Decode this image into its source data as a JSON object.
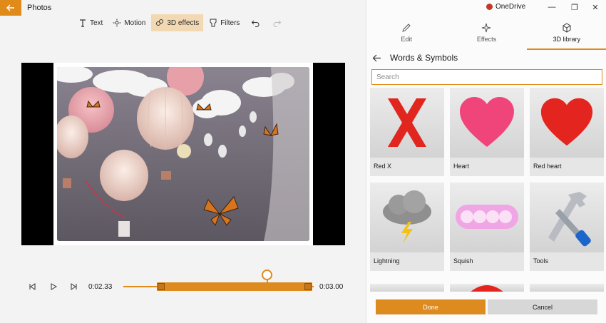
{
  "app": {
    "title": "Photos"
  },
  "toolbar": {
    "text_label": "Text",
    "motion_label": "Motion",
    "effects3d_label": "3D effects",
    "filters_label": "Filters"
  },
  "timeline": {
    "current_time": "0:02.33",
    "end_time": "0:03.00",
    "trim_start": 0.09,
    "trim_end": 1.0,
    "playhead": 0.7
  },
  "window": {
    "onedrive_label": "OneDrive"
  },
  "panel": {
    "tabs": [
      {
        "label": "Edit",
        "icon": "pencil-icon"
      },
      {
        "label": "Effects",
        "icon": "sparkle-icon"
      },
      {
        "label": "3D library",
        "icon": "cube-icon",
        "active": true
      }
    ],
    "section_title": "Words & Symbols",
    "search_placeholder": "Search",
    "items": [
      {
        "label": "Red X",
        "icon": "red-x-model"
      },
      {
        "label": "Heart",
        "icon": "heart-model"
      },
      {
        "label": "Red heart",
        "icon": "red-heart-model"
      },
      {
        "label": "Lightning",
        "icon": "lightning-cloud-model"
      },
      {
        "label": "Squish",
        "icon": "squish-text-model"
      },
      {
        "label": "Tools",
        "icon": "wrench-screwdriver-model"
      }
    ],
    "done_label": "Done",
    "cancel_label": "Cancel"
  },
  "colors": {
    "accent": "#e08a1a",
    "done_button": "#dd8a1f",
    "cancel_button": "#d7d7d7"
  }
}
